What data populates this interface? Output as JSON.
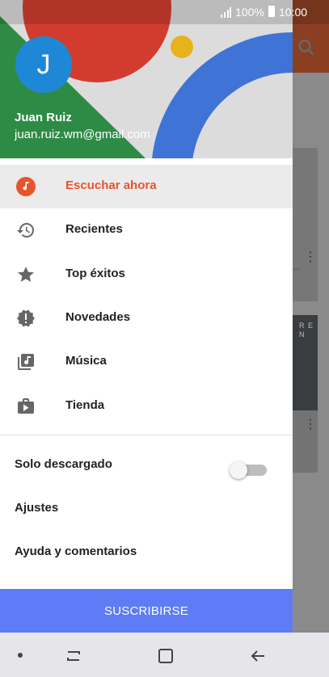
{
  "status_bar": {
    "battery_pct": "100%",
    "time": "10:00"
  },
  "account": {
    "avatar_letter": "J",
    "name": "Juan Ruiz",
    "email": "juan.ruiz.wm@gmail.com"
  },
  "menu": [
    {
      "label": "Escuchar ahora",
      "icon": "music-note-icon",
      "active": true
    },
    {
      "label": "Recientes",
      "icon": "history-icon"
    },
    {
      "label": "Top éxitos",
      "icon": "star-icon"
    },
    {
      "label": "Novedades",
      "icon": "new-release-icon"
    },
    {
      "label": "Música",
      "icon": "library-music-icon"
    },
    {
      "label": "Tienda",
      "icon": "store-icon"
    }
  ],
  "options": {
    "downloaded_only": {
      "label": "Solo descargado",
      "enabled": false
    },
    "settings": "Ajustes",
    "help": "Ayuda y comentarios"
  },
  "subscribe_label": "SUSCRIBIRSE",
  "background": {
    "card_text_fragment": "...",
    "card_image_text": "R E N"
  },
  "colors": {
    "accent": "#e8542c",
    "subscribe": "#5d7cf5",
    "avatar": "#1e88d6"
  }
}
